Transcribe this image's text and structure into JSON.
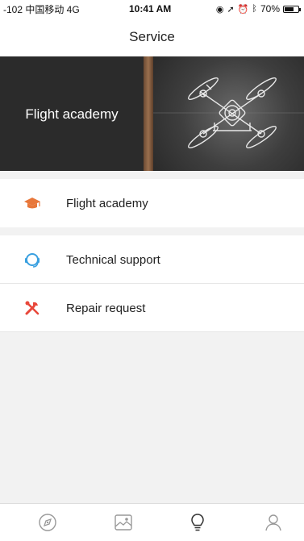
{
  "status_bar": {
    "carrier": "-102 中国移动  4G",
    "time": "10:41 AM",
    "battery": "70%",
    "battery_level": 0.7
  },
  "nav": {
    "title": "Service"
  },
  "banner": {
    "title": "Flight academy"
  },
  "menu_sections": [
    {
      "items": [
        {
          "label": "Flight academy",
          "icon": "graduation-cap-icon",
          "color": "#e8773a"
        }
      ]
    },
    {
      "items": [
        {
          "label": "Technical support",
          "icon": "headset-icon",
          "color": "#3aa0e0"
        },
        {
          "label": "Repair request",
          "icon": "tools-icon",
          "color": "#e8473a"
        }
      ]
    }
  ],
  "tab_bar": {
    "tabs": [
      {
        "name": "compass-tab",
        "icon": "compass-icon",
        "active": false
      },
      {
        "name": "gallery-tab",
        "icon": "image-icon",
        "active": false
      },
      {
        "name": "service-tab",
        "icon": "lightbulb-icon",
        "active": true
      },
      {
        "name": "profile-tab",
        "icon": "user-icon",
        "active": false
      }
    ]
  },
  "colors": {
    "icon_gray": "#999999",
    "active_tab": "#333333"
  }
}
